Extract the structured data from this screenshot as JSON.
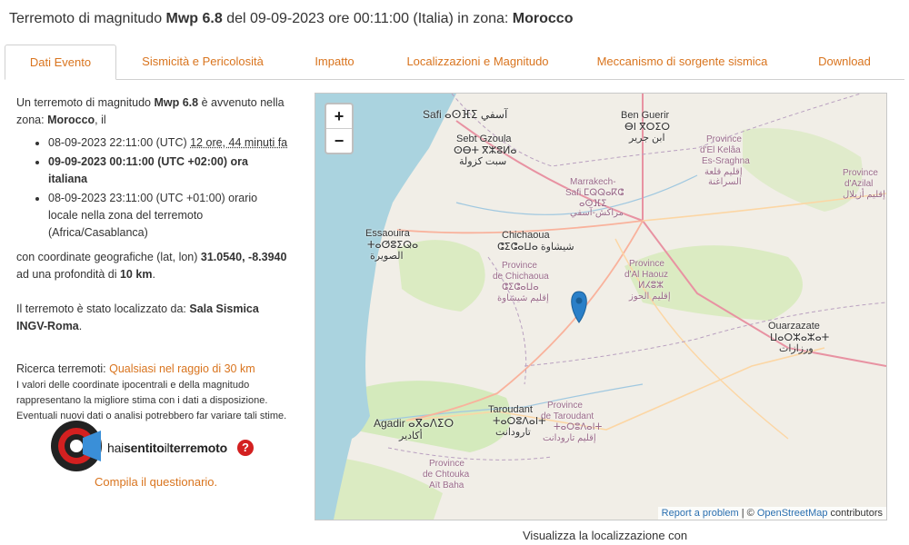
{
  "header": {
    "t1": "Terremoto di magnitudo ",
    "mag": "Mwp 6.8",
    "t2": " del 09-09-2023 ore 00:11:00 (Italia) in zona: ",
    "zone": "Morocco"
  },
  "tabs": [
    {
      "label": "Dati Evento"
    },
    {
      "label": "Sismicità e Pericolosità"
    },
    {
      "label": "Impatto"
    },
    {
      "label": "Localizzazioni e Magnitudo"
    },
    {
      "label": "Meccanismo di sorgente sismica"
    },
    {
      "label": "Download"
    }
  ],
  "left": {
    "intro1": "Un terremoto di magnitudo ",
    "intro_mag": "Mwp 6.8",
    "intro2": " è avvenuto nella zona: ",
    "intro_zone": "Morocco",
    "intro3": ", il",
    "utc": "08-09-2023 22:11:00 (UTC) ",
    "ago": "12 ore, 44 minuti fa",
    "italy": "09-09-2023 00:11:00 (UTC +02:00) ora italiana",
    "local": "08-09-2023 23:11:00 (UTC +01:00) orario locale nella zona del terremoto (Africa/Casablanca)",
    "coords1": "con coordinate geografiche (lat, lon) ",
    "coords": "31.0540, -8.3940",
    "coords2": " ad una profondità di ",
    "depth": "10 km",
    "coords3": ".",
    "loc1": "Il terremoto è stato localizzato da: ",
    "loc_by": "Sala Sismica INGV-Roma",
    "loc2": ".",
    "search_label": "Ricerca terremoti: ",
    "search_link": "Qualsiasi nel raggio di 30 km",
    "note": "I valori delle coordinate ipocentrali e della magnitudo rappresentano la migliore stima con i dati a disposizione. Eventuali nuovi dati o analisi potrebbero far variare tali stime.",
    "hsit_a": "hai",
    "hsit_b": "sentito",
    "hsit_c": "il",
    "hsit_d": "terremoto",
    "hsit_q": "?",
    "compile": "Compila il questionario."
  },
  "map": {
    "zoom_in": "+",
    "zoom_out": "−",
    "report": "Report a problem",
    "sep": " | © ",
    "osm": "OpenStreetMap",
    "contrib": " contributors",
    "labels": {
      "safi": "Safi ⴰⵙⴼⵉ آسفي",
      "benguerir": "Ben Guerir",
      "benguerir2": "ⴱⵏ ⴳⵔⵉⵔ",
      "benguerir3": "ابن جرير",
      "sebt": "Sebt Gzoula",
      "sebt2": "ⵙⴱⵜ ⴳⵣⵓⵍⴰ",
      "sebt3": "سبت كزولة",
      "marrakech": "Marrakech-",
      "marrakech2": "Safi ⵎⵕⵕⴰⴽⵛ",
      "marrakech3": "ⴰⵙⴼⵉ",
      "marrakech4": "مراكش-آسفي",
      "kelaa": "Province",
      "kelaa2": "d'El Kelâa",
      "kelaa3": "Es-Sraghna",
      "kelaa4": "إقليم قلعة",
      "kelaa5": "السراغنة",
      "azilal": "Province",
      "azilal2": "d'Azilal",
      "azilal3": "إقليم أزيلال",
      "essaouira": "Essaouira",
      "essaouira2": "ⵜⴰⵚⵓⵉⵕⴰ",
      "essaouira3": "الصويرة",
      "chichaoua": "Chichaoua",
      "chichaoua2": "ⵛⵉⵛⴰⵡⴰ شيشاوة",
      "provchich": "Province",
      "provchich2": "de Chichaoua",
      "provchich3": "ⵛⵉⵛⴰⵡⴰ",
      "provchich4": "إقليم شيشاوة",
      "haouz": "Province",
      "haouz2": "d'Al Haouz",
      "haouz3": "ⵍⵃⵓⵣ",
      "haouz4": "إقليم الحوز",
      "ouarzazate": "Ouarzazate",
      "ouarzazate2": "ⵡⴰⵔⵣⴰⵣⴰⵜ",
      "ouarzazate3": "ورزازات",
      "taroudant": "Taroudant",
      "taroudant2": "ⵜⴰⵔⵓⴷⴰⵏⵜ",
      "taroudant3": "تارودانت",
      "provtar": "Province",
      "provtar2": "de Taroudant",
      "provtar3": "ⵜⴰⵔⵓⴷⴰⵏⵜ",
      "provtar4": "إقليم تارودانت",
      "agadir": "Agadir ⴰⴳⴰⴷⵉⵔ",
      "agadir2": "أكادير",
      "chtouka": "Province",
      "chtouka2": "de Chtouka",
      "chtouka3": "Aït Baha"
    }
  },
  "caption": "Visualizza la localizzazione con",
  "colors": {
    "accent": "#d9741e",
    "sea": "#aad3df",
    "marker": "#2a7fc8",
    "land": "#f1eee7",
    "green": "#cde8b2"
  }
}
